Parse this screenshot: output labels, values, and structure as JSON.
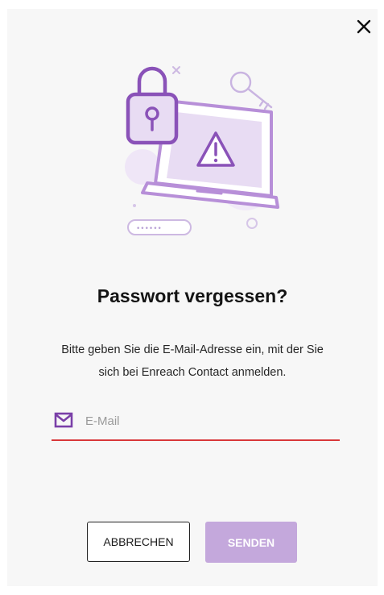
{
  "dialog": {
    "title": "Passwort vergessen?",
    "description": "Bitte geben Sie die E-Mail-Adresse ein, mit der Sie sich bei Enreach Contact anmelden.",
    "email_field": {
      "icon": "mail-icon",
      "placeholder": "E-Mail",
      "value": ""
    },
    "buttons": {
      "cancel_label": "ABBRECHEN",
      "send_label": "SENDEN"
    },
    "close_icon": "close-icon",
    "illustration": {
      "password_mask": "••••••",
      "icons": [
        "padlock-icon",
        "key-icon",
        "laptop-icon",
        "warning-icon"
      ]
    }
  },
  "colors": {
    "accent_purple": "#7a3fa8",
    "illustration_purple": "#b78fd8",
    "illustration_fill": "#e8dcf3",
    "error_underline": "#d9383a",
    "send_button_disabled": "#c4a8dc",
    "dialog_background": "#f7f7f7"
  }
}
